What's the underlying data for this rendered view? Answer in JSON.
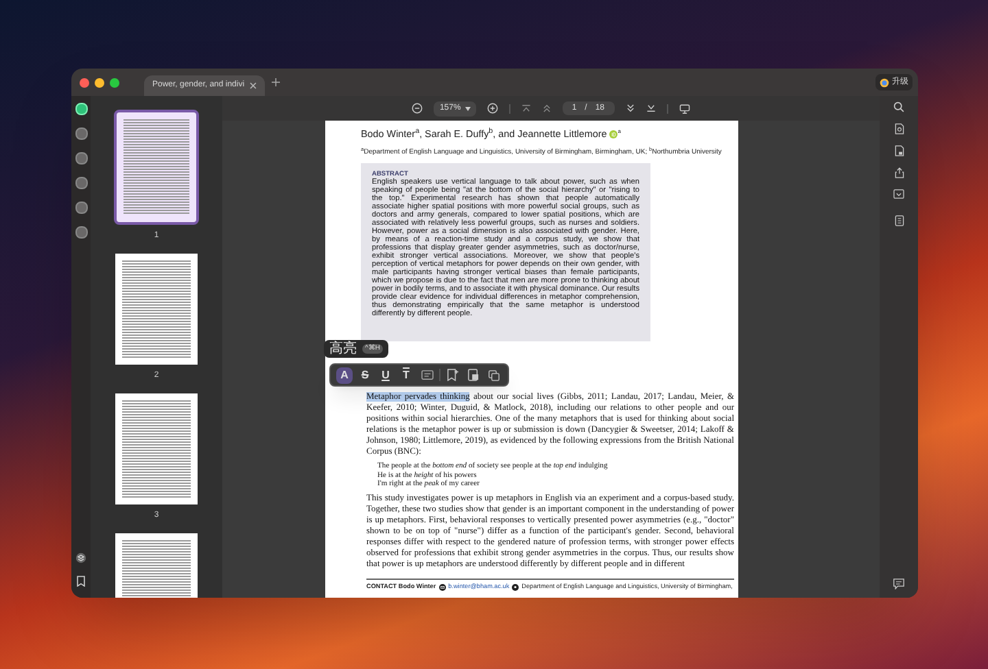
{
  "tab": {
    "title": "Power, gender, and indivi",
    "selected": true
  },
  "upgrade": "升级",
  "toolbar": {
    "zoom": "157%",
    "page": "1",
    "separator": "/",
    "total": "18"
  },
  "left_rail": [
    {
      "selected": true
    },
    {
      "selected": false
    },
    {
      "selected": false
    },
    {
      "selected": false
    },
    {
      "selected": false
    },
    {
      "selected": false
    }
  ],
  "thumbnails": [
    {
      "label": "1",
      "selected": true
    },
    {
      "label": "2",
      "selected": false
    },
    {
      "label": "3",
      "selected": false
    },
    {
      "selected": false
    }
  ],
  "document": {
    "authors": "Bodo Winter$^{a}$, Sarah E. Duffy$^{b}$, and Jeannette Littlemore",
    "author_mark": "a",
    "affiliation": "$^{a}$Department of English Language and Linguistics, University of Birmingham, Birmingham, UK; $^{b}$Northumbria University",
    "abstract_heading": "ABSTRACT",
    "abstract": "English speakers use vertical language to talk about power, such as when speaking of people being \"at the bottom of the social hierarchy\" or \"rising to the top.\" Experimental research has shown that people automatically associate higher spatial positions with more powerful social groups, such as doctors and army generals, compared to lower spatial positions, which are associated with relatively less powerful groups, such as nurses and soldiers. However, power as a social dimension is also associated with gender. Here, by means of a reaction-time study and a corpus study, we show that professions that display greater gender asymmetries, such as doctor/nurse, exhibit stronger vertical associations. Moreover, we show that people's perception of vertical metaphors for power depends on their own gender, with male participants having stronger vertical biases than female participants, which we propose is due to the fact that men are more prone to thinking about power in bodily terms, and to associate it with physical dominance. Our results provide clear evidence for individual differences in metaphor comprehension, thus demonstrating empirically that the same metaphor is understood differently by different people.",
    "selected_text": "Metaphor pervades thinking",
    "paragraph_1_rest": " about our social lives (Gibbs, 2011; Landau, 2017; Landau, Meier, & Keefer, 2010; Winter, Duguid, & Matlock, 2018), including our relations to other people and our positions within social hierarchies. One of the many metaphors that is used for thinking about social relations is the metaphor power is up or submission is down (Dancygier & Sweetser, 2014; Lakoff & Johnson, 1980; Littlemore, 2019), as evidenced by the following expressions from the British National Corpus (BNC):",
    "examples": [
      "The people at the *bottom end* of society see people at the *top end* indulging",
      "He is at the *height* of his powers",
      "I'm right at the *peak* of my career"
    ],
    "paragraph_2": "This study investigates power is up metaphors in English via an experiment and a corpus-based study. Together, these two studies show that gender is an important component in the understanding of power is up metaphors. First, behavioral responses to vertically presented power asymmetries (e.g., \"doctor\" shown to be on top of \"nurse\") differ as a function of the participant's gender. Second, behavioral responses differ with respect to the gendered nature of profession terms, with stronger power effects observed for professions that exhibit strong gender asymmetries in the corpus. Thus, our results show that power is up metaphors are understood differently by different people and in different",
    "contact_label": "CONTACT Bodo Winter",
    "contact_email": "b.winter@bham.ac.uk",
    "contact_address": "Department of English Language and Linguistics, University of Birmingham,"
  },
  "annotation_toolbar": {
    "tooltip": "高亮",
    "shortcut": "^⌘H",
    "tools": [
      {
        "kind": "highlight",
        "glyph": "A",
        "selected": true
      },
      {
        "kind": "strikethrough",
        "glyph": "S",
        "selected": false
      },
      {
        "kind": "underline",
        "glyph": "U",
        "selected": false
      },
      {
        "kind": "squiggly",
        "glyph": "T",
        "selected": false
      },
      {
        "kind": "note",
        "selected": false
      },
      {
        "kind": "bookmark",
        "selected": false
      },
      {
        "kind": "extract",
        "selected": false
      },
      {
        "kind": "copy",
        "selected": false
      }
    ]
  }
}
